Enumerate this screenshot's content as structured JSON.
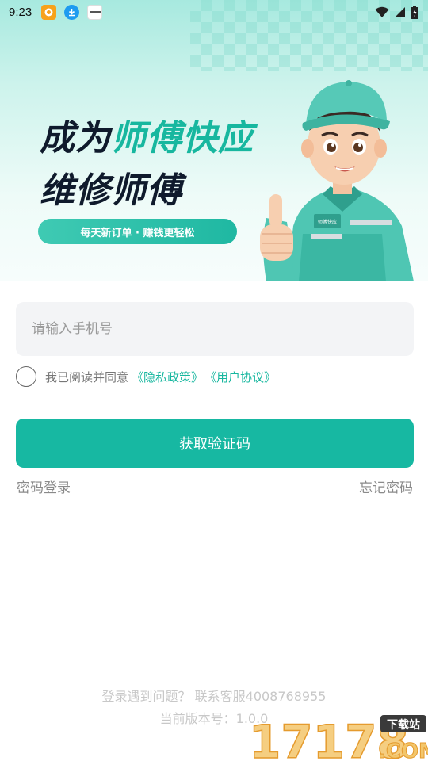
{
  "status_bar": {
    "time": "9:23",
    "icons": [
      "app-notification-icon",
      "download-icon",
      "app-notification-icon-2",
      "wifi-icon",
      "signal-icon",
      "battery-charging-icon"
    ]
  },
  "banner": {
    "headline_part1": "成为",
    "headline_part2": "师傅快应",
    "headline_line2": "维修师傅",
    "slogan": "每天新订单 · 赚钱更轻松",
    "badge_text": "师傅快应",
    "colors": {
      "accent": "#17b79f",
      "dark": "#0f1a2c"
    }
  },
  "form": {
    "phone_placeholder": "请输入手机号",
    "phone_value": "",
    "agree_text": "我已阅读并同意",
    "privacy_link": "《隐私政策》",
    "user_agreement_link": "《用户协议》",
    "agree_checked": false,
    "get_code_button": "获取验证码",
    "password_login": "密码登录",
    "forgot_password": "忘记密码"
  },
  "footer": {
    "contact": "登录遇到问题？ 联系客服4008768955",
    "version": "当前版本号：1.0.0"
  },
  "watermark": {
    "number": "17178",
    "tag": "下载站",
    "domain": ".COM"
  }
}
